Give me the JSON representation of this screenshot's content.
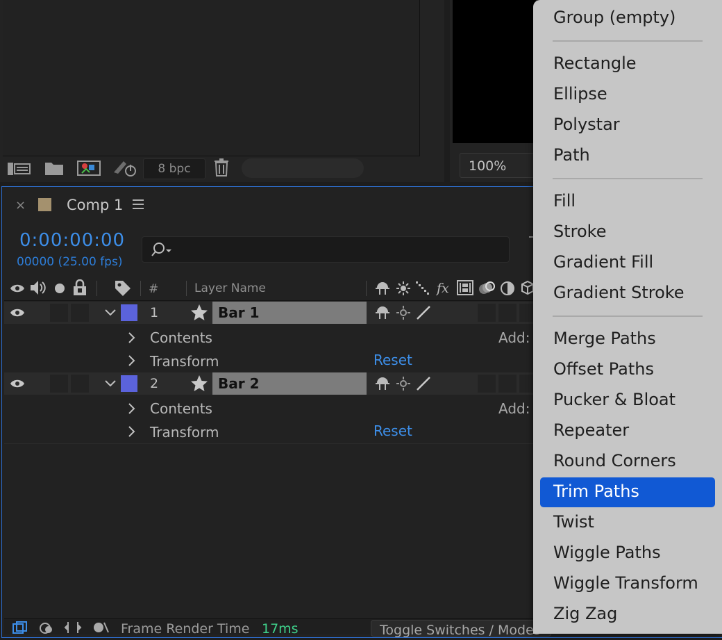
{
  "project_panel": {
    "bit_depth": "8 bpc"
  },
  "viewer": {
    "zoom": "100%"
  },
  "timeline": {
    "tab": {
      "close": "×",
      "title": "Comp 1"
    },
    "timecode": "0:00:00:00",
    "frames": "00000 (25.00 fps)",
    "headers": {
      "hash": "#",
      "layer_name": "Layer Name"
    },
    "layers": [
      {
        "number": "1",
        "name": "Bar 1",
        "contents": "Contents",
        "transform": "Transform",
        "reset": "Reset",
        "add": "Add:"
      },
      {
        "number": "2",
        "name": "Bar 2",
        "contents": "Contents",
        "transform": "Transform",
        "reset": "Reset",
        "add": "Add:"
      }
    ],
    "footer": {
      "frame_render_label": "Frame Render Time",
      "frame_render_value": "17ms",
      "toggle": "Toggle Switches / Modes"
    }
  },
  "context_menu": {
    "items": [
      "Group (empty)",
      "Rectangle",
      "Ellipse",
      "Polystar",
      "Path",
      "Fill",
      "Stroke",
      "Gradient Fill",
      "Gradient Stroke",
      "Merge Paths",
      "Offset Paths",
      "Pucker & Bloat",
      "Repeater",
      "Round Corners",
      "Trim Paths",
      "Twist",
      "Wiggle Paths",
      "Wiggle Transform",
      "Zig Zag"
    ],
    "highlighted": "Trim Paths",
    "colors": {
      "highlight": "#1159d4",
      "highlight_text": "#ffffff"
    }
  },
  "colors": {
    "accent_blue": "#3d8ee8",
    "layer_label": "#5b63dc",
    "render_time": "#3fd18b"
  }
}
